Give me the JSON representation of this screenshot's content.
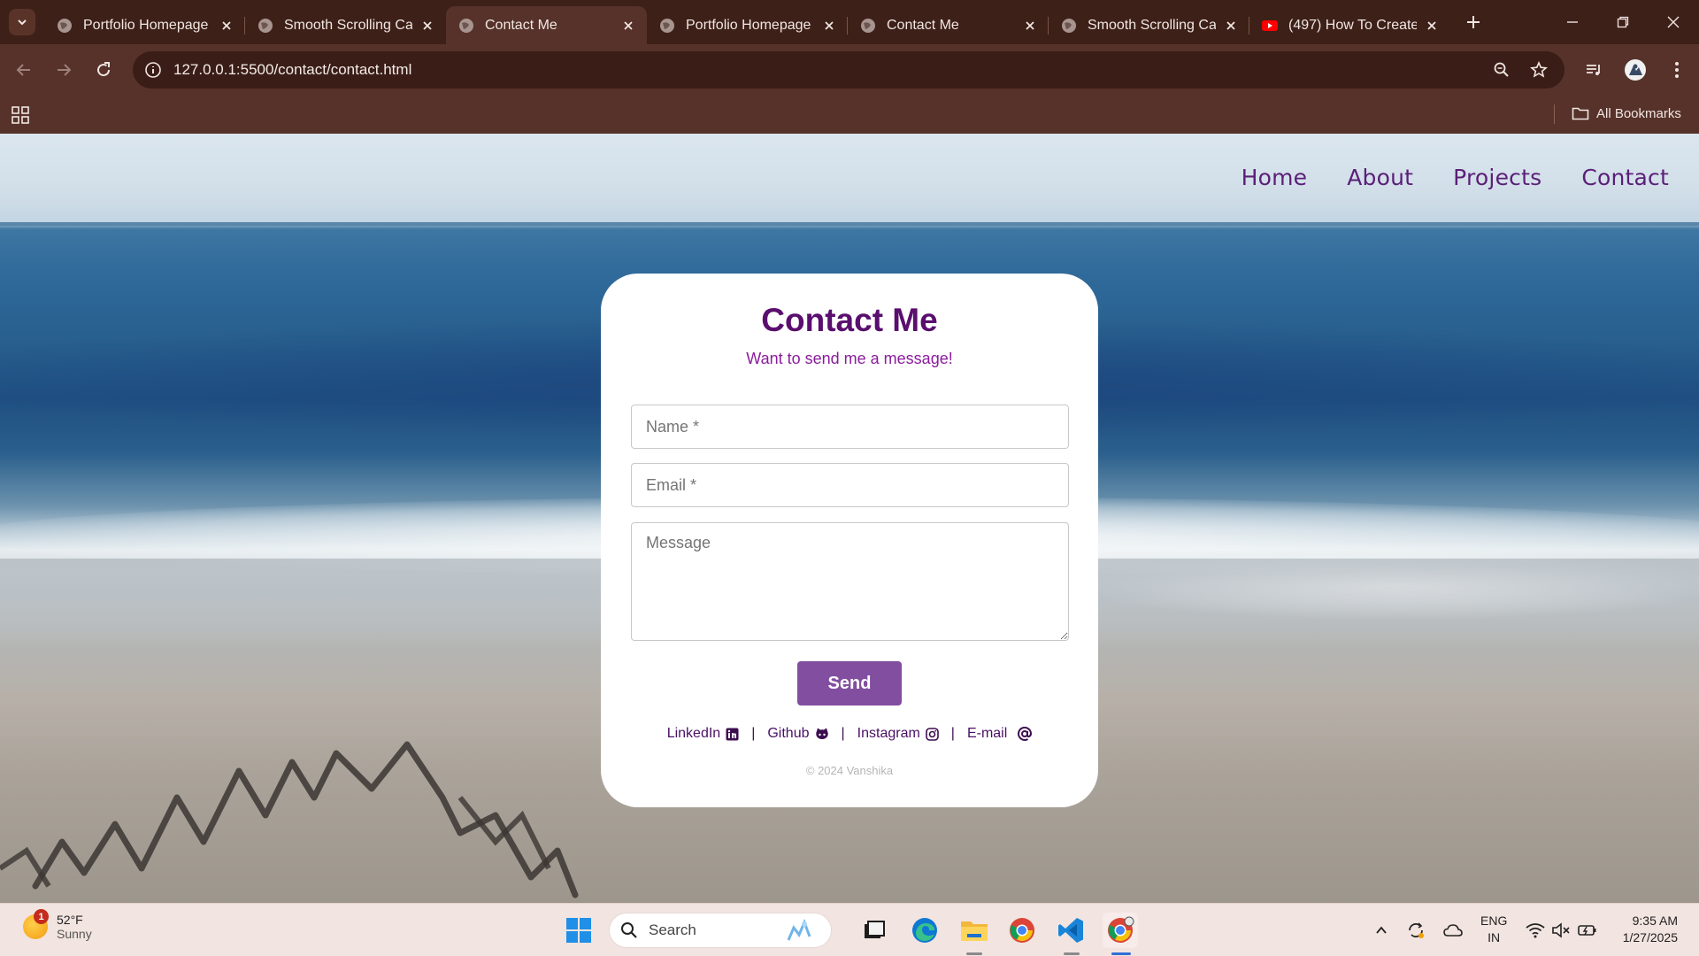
{
  "browser": {
    "tabs": [
      {
        "title": "Portfolio Homepage",
        "favicon": "globe-icon",
        "active": false
      },
      {
        "title": "Smooth Scrolling Car",
        "favicon": "globe-icon",
        "active": false
      },
      {
        "title": "Contact Me",
        "favicon": "globe-icon",
        "active": true
      },
      {
        "title": "Portfolio Homepage",
        "favicon": "globe-icon",
        "active": false
      },
      {
        "title": "Contact Me",
        "favicon": "globe-icon",
        "active": false
      },
      {
        "title": "Smooth Scrolling Car",
        "favicon": "globe-icon",
        "active": false
      },
      {
        "title": "(497) How To Create",
        "favicon": "youtube-icon",
        "active": false
      }
    ],
    "url": "127.0.0.1:5500/contact/contact.html",
    "all_bookmarks_label": "All Bookmarks"
  },
  "site": {
    "nav": [
      "Home",
      "About",
      "Projects",
      "Contact"
    ],
    "card": {
      "title": "Contact Me",
      "subtitle": "Want to send me a message!",
      "name_placeholder": "Name *",
      "email_placeholder": "Email *",
      "message_placeholder": "Message",
      "send_label": "Send",
      "links": [
        {
          "label": "LinkedIn",
          "icon": "linkedin-icon"
        },
        {
          "label": "Github",
          "icon": "github-icon"
        },
        {
          "label": "Instagram",
          "icon": "instagram-icon"
        },
        {
          "label": "E-mail",
          "icon": "at-icon"
        }
      ],
      "separator": "|",
      "copyright": "© 2024 Vanshika"
    }
  },
  "taskbar": {
    "weather_temp": "52°F",
    "weather_desc": "Sunny",
    "weather_badge": "1",
    "search_label": "Search",
    "lang_top": "ENG",
    "lang_bottom": "IN",
    "time": "9:35 AM",
    "date": "1/27/2025"
  },
  "colors": {
    "accent_purple": "#824ea0",
    "title_purple": "#5a0e6e",
    "nav_purple": "#5b1f78",
    "chrome_brown": "#56322a"
  }
}
